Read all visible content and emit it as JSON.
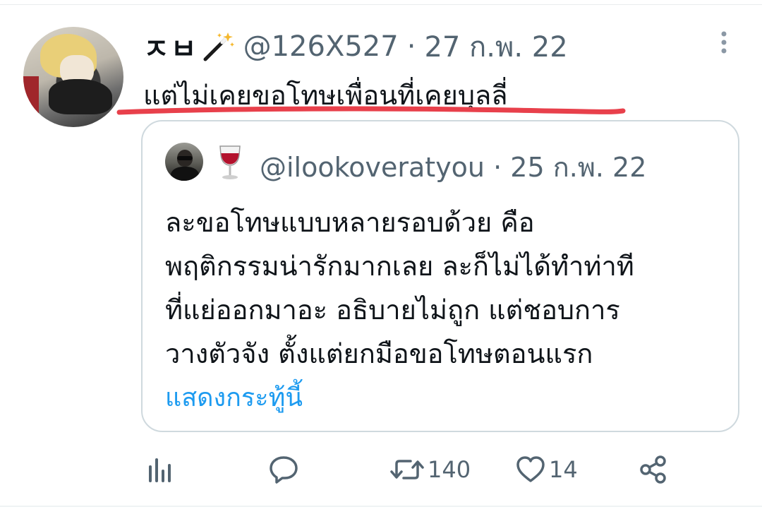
{
  "tweet": {
    "display_name": "ㅈㅂ",
    "handle": "@126X527",
    "separator": "·",
    "date": "27 ก.พ. 22",
    "text": "แต่ไม่เคยขอโทษเพื่อนที่เคยบุลลี่"
  },
  "quote": {
    "handle": "@ilookoveratyou",
    "separator": "·",
    "date": "25 ก.พ. 22",
    "lines": [
      "ละขอโทษแบบหลายรอบด้วย คือ",
      "พฤติกรรมน่ารักมากเลย ละก็ไม่ได้ทำท่าที",
      "ที่แย่ออกมาอะ อธิบายไม่ถูก แต่ชอบการ",
      "วางตัวจัง ตั้งแต่ยกมือขอโทษตอนแรก"
    ],
    "show_more": "แสดงกระทู้นี้"
  },
  "actions": {
    "retweets": "140",
    "likes": "14"
  },
  "icons": {
    "display_name_emoji": "magic-wand-icon",
    "quote_emoji": "wine-glass-icon",
    "more": "more-vertical-icon",
    "views": "analytics-icon",
    "reply": "reply-icon",
    "retweet": "retweet-icon",
    "like": "heart-icon",
    "share": "share-icon"
  },
  "colors": {
    "text": "#0f1419",
    "secondary": "#536471",
    "link": "#1d9bf0",
    "border": "#cfd9de",
    "underline_mark": "#e8404b"
  }
}
